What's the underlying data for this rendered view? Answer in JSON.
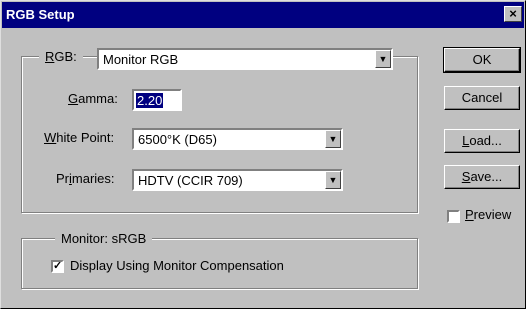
{
  "window": {
    "title": "RGB Setup",
    "close_glyph": "×"
  },
  "rgb_group": {
    "label": "RGB:",
    "selected": "Monitor RGB",
    "gamma_label": "Gamma:",
    "gamma_value": "2.20",
    "white_point_label": "White Point:",
    "white_point_value": "6500°K (D65)",
    "primaries_label": "Primaries:",
    "primaries_value": "HDTV (CCIR 709)"
  },
  "monitor_group": {
    "label": "Monitor:  sRGB",
    "compensation_label": "Display Using Monitor Compensation",
    "compensation_checked": true
  },
  "buttons": {
    "ok": "OK",
    "cancel": "Cancel",
    "load": "Load...",
    "save": "Save..."
  },
  "preview": {
    "label": "Preview",
    "checked": false
  },
  "icons": {
    "dropdown": "chevron-down-icon",
    "close": "close-icon",
    "check": "checkmark-icon"
  }
}
